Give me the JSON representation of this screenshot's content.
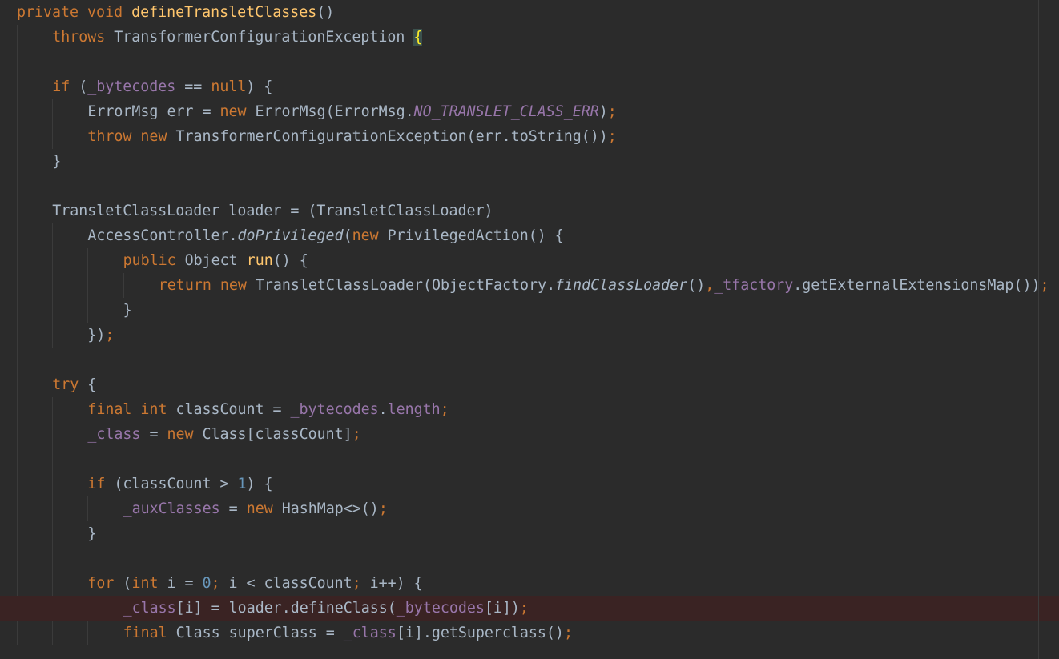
{
  "editor": {
    "lines": [
      {
        "indent": 0,
        "tokens": [
          [
            "kw",
            "private void "
          ],
          [
            "fn",
            "defineTransletClasses"
          ],
          [
            "t",
            "()"
          ]
        ]
      },
      {
        "indent": 1,
        "tokens": [
          [
            "kw",
            "throws "
          ],
          [
            "t",
            "TransformerConfigurationException "
          ],
          [
            "match",
            "{"
          ]
        ]
      },
      {
        "indent": 0,
        "tokens": []
      },
      {
        "indent": 1,
        "tokens": [
          [
            "kw",
            "if "
          ],
          [
            "t",
            "("
          ],
          [
            "fld",
            "_bytecodes"
          ],
          [
            "t",
            " == "
          ],
          [
            "kw",
            "null"
          ],
          [
            "t",
            ") {"
          ]
        ]
      },
      {
        "indent": 2,
        "tokens": [
          [
            "t",
            "ErrorMsg err = "
          ],
          [
            "kw",
            "new "
          ],
          [
            "t",
            "ErrorMsg(ErrorMsg."
          ],
          [
            "fldi",
            "NO_TRANSLET_CLASS_ERR"
          ],
          [
            "t",
            ")"
          ],
          [
            "kw",
            ";"
          ]
        ]
      },
      {
        "indent": 2,
        "tokens": [
          [
            "kw",
            "throw new "
          ],
          [
            "t",
            "TransformerConfigurationException(err.toString())"
          ],
          [
            "kw",
            ";"
          ]
        ]
      },
      {
        "indent": 1,
        "tokens": [
          [
            "t",
            "}"
          ]
        ]
      },
      {
        "indent": 0,
        "tokens": []
      },
      {
        "indent": 1,
        "tokens": [
          [
            "t",
            "TransletClassLoader loader = (TransletClassLoader)"
          ]
        ]
      },
      {
        "indent": 2,
        "tokens": [
          [
            "t",
            "AccessController."
          ],
          [
            "it",
            "doPrivileged"
          ],
          [
            "t",
            "("
          ],
          [
            "kw",
            "new "
          ],
          [
            "t",
            "PrivilegedAction() {"
          ]
        ]
      },
      {
        "indent": 3,
        "tokens": [
          [
            "kw",
            "public "
          ],
          [
            "t",
            "Object "
          ],
          [
            "fn",
            "run"
          ],
          [
            "t",
            "() {"
          ]
        ]
      },
      {
        "indent": 4,
        "tokens": [
          [
            "kw",
            "return new "
          ],
          [
            "t",
            "TransletClassLoader(ObjectFactory."
          ],
          [
            "it",
            "findClassLoader"
          ],
          [
            "t",
            "()"
          ],
          [
            "kw",
            ","
          ],
          [
            "fld",
            "_tfactory"
          ],
          [
            "t",
            ".getExternalExtensionsMap())"
          ],
          [
            "kw",
            ";"
          ]
        ]
      },
      {
        "indent": 3,
        "tokens": [
          [
            "t",
            "}"
          ]
        ]
      },
      {
        "indent": 2,
        "tokens": [
          [
            "t",
            "})"
          ],
          [
            "kw",
            ";"
          ]
        ]
      },
      {
        "indent": 0,
        "tokens": []
      },
      {
        "indent": 1,
        "tokens": [
          [
            "kw",
            "try "
          ],
          [
            "t",
            "{"
          ]
        ]
      },
      {
        "indent": 2,
        "tokens": [
          [
            "kw",
            "final int "
          ],
          [
            "t",
            "classCount = "
          ],
          [
            "fld",
            "_bytecodes"
          ],
          [
            "t",
            "."
          ],
          [
            "fld",
            "length"
          ],
          [
            "kw",
            ";"
          ]
        ]
      },
      {
        "indent": 2,
        "tokens": [
          [
            "fld",
            "_class"
          ],
          [
            "t",
            " = "
          ],
          [
            "kw",
            "new "
          ],
          [
            "t",
            "Class[classCount]"
          ],
          [
            "kw",
            ";"
          ]
        ]
      },
      {
        "indent": 0,
        "tokens": []
      },
      {
        "indent": 2,
        "tokens": [
          [
            "kw",
            "if "
          ],
          [
            "t",
            "(classCount > "
          ],
          [
            "num",
            "1"
          ],
          [
            "t",
            ") {"
          ]
        ]
      },
      {
        "indent": 3,
        "tokens": [
          [
            "fld",
            "_auxClasses"
          ],
          [
            "t",
            " = "
          ],
          [
            "kw",
            "new "
          ],
          [
            "t",
            "HashMap<>()"
          ],
          [
            "kw",
            ";"
          ]
        ]
      },
      {
        "indent": 2,
        "tokens": [
          [
            "t",
            "}"
          ]
        ]
      },
      {
        "indent": 0,
        "tokens": []
      },
      {
        "indent": 2,
        "tokens": [
          [
            "kw",
            "for "
          ],
          [
            "t",
            "("
          ],
          [
            "kw",
            "int "
          ],
          [
            "t",
            "i = "
          ],
          [
            "num",
            "0"
          ],
          [
            "kw",
            "; "
          ],
          [
            "t",
            "i < classCount"
          ],
          [
            "kw",
            "; "
          ],
          [
            "t",
            "i++) {"
          ]
        ]
      },
      {
        "indent": 3,
        "highlight": true,
        "tokens": [
          [
            "fld",
            "_class"
          ],
          [
            "t",
            "[i] = loader.defineClass("
          ],
          [
            "fld",
            "_bytecodes"
          ],
          [
            "t",
            "[i])"
          ],
          [
            "kw",
            ";"
          ]
        ]
      },
      {
        "indent": 3,
        "tokens": [
          [
            "kw",
            "final "
          ],
          [
            "t",
            "Class superClass = "
          ],
          [
            "fld",
            "_class"
          ],
          [
            "t",
            "[i].getSuperclass()"
          ],
          [
            "kw",
            ";"
          ]
        ]
      }
    ]
  },
  "colors": {
    "background": "#2b2b2b",
    "keyword": "#cc7832",
    "method_decl": "#ffc66d",
    "field": "#9876aa",
    "number": "#6897bb",
    "text": "#a9b7c6",
    "breakpoint_line": "#3a2323"
  }
}
